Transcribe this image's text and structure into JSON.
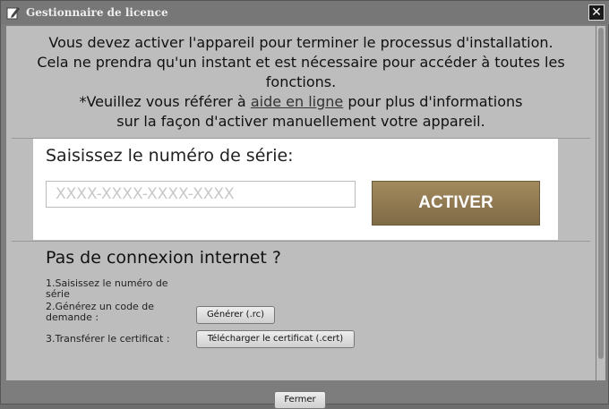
{
  "window": {
    "title": "Gestionnaire de licence",
    "close_glyph": "✕"
  },
  "intro": {
    "line1": "Vous devez activer l'appareil pour terminer le processus d'installation.",
    "line2": "Cela ne prendra qu'un instant et est nécessaire pour accéder à toutes les",
    "line3": "fonctions.",
    "line4_prefix": "*Veuillez vous référer à",
    "line4_link": "aide en ligne",
    "line4_suffix": "pour plus d'informations",
    "line5": "sur la façon d'activer manuellement votre appareil."
  },
  "serial": {
    "label": "Saisissez le numéro de série:",
    "placeholder": "XXXX-XXXX-XXXX-XXXX",
    "value": "",
    "activate_label": "ACTIVER"
  },
  "offline": {
    "title": "Pas de connexion internet ?",
    "step1": "1.Saisissez le numéro de série",
    "step2": "2.Générez un code de demande :",
    "step2_button": "Générer (.rc)",
    "step3": "3.Transférer le certificat :",
    "step3_button": "Télécharger le certificat (.cert)"
  },
  "footer": {
    "close_label": "Fermer"
  },
  "icons": {
    "title": "edit-pencil-icon",
    "close": "close-icon"
  },
  "colors": {
    "accent": "#9a8258",
    "window_bg": "#7d7d7d",
    "content_bg": "#bdbdbd"
  }
}
